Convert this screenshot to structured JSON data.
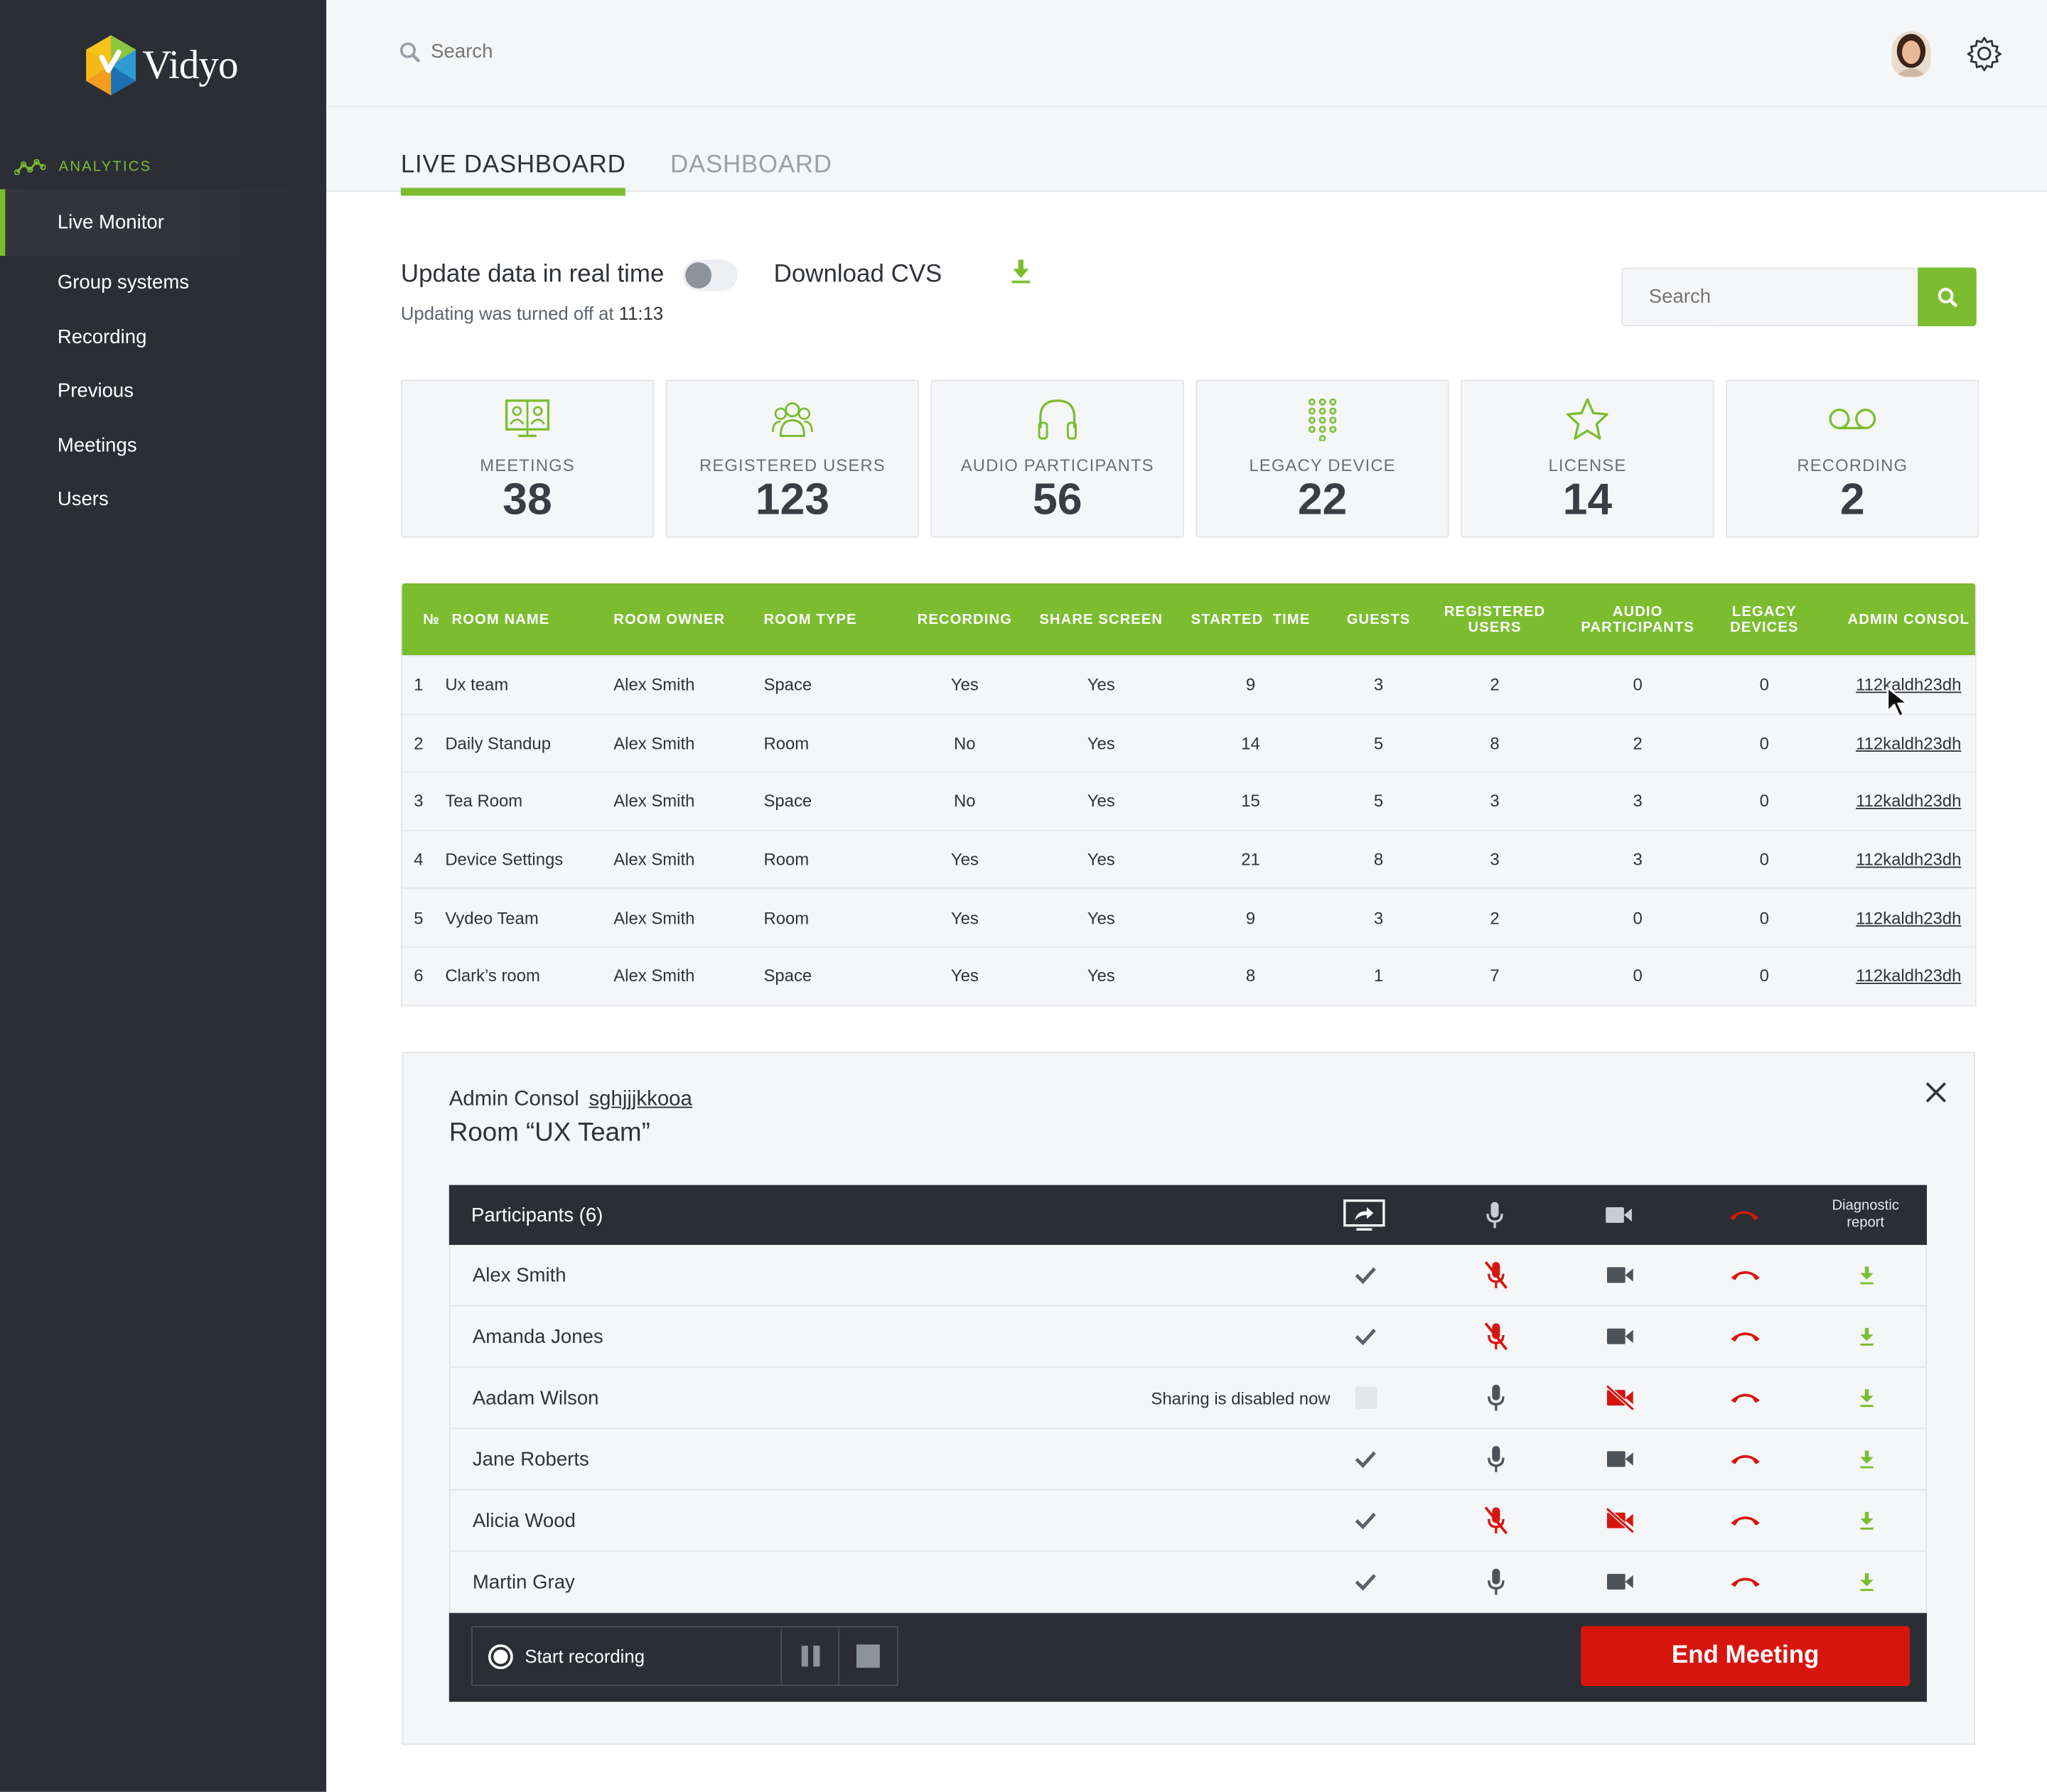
{
  "brand": {
    "name": "Vidyo"
  },
  "sidebar": {
    "section": "ANALYTICS",
    "items": [
      {
        "label": "Live Monitor",
        "active": true
      },
      {
        "label": "Group systems"
      },
      {
        "label": "Recording"
      },
      {
        "label": "Previous"
      },
      {
        "label": "Meetings"
      },
      {
        "label": "Users"
      }
    ]
  },
  "topbar": {
    "search_placeholder": "Search"
  },
  "tabs": [
    {
      "label": "LIVE DASHBOARD",
      "active": true
    },
    {
      "label": "DASHBOARD",
      "active": false
    }
  ],
  "controls": {
    "update_label": "Update data in real time",
    "update_on": false,
    "download_label": "Download CVS",
    "status_prefix": "Updating was turned off at",
    "status_time": "11:13",
    "search_placeholder": "Search"
  },
  "stats": [
    {
      "label": "MEETINGS",
      "value": "38",
      "icon": "meetings-icon"
    },
    {
      "label": "REGISTERED USERS",
      "value": "123",
      "icon": "users-group-icon"
    },
    {
      "label": "AUDIO PARTICIPANTS",
      "value": "56",
      "icon": "headphones-icon"
    },
    {
      "label": "LEGACY DEVICE",
      "value": "22",
      "icon": "keypad-icon"
    },
    {
      "label": "LICENSE",
      "value": "14",
      "icon": "star-icon"
    },
    {
      "label": "RECORDING",
      "value": "2",
      "icon": "voicemail-icon"
    }
  ],
  "rooms_table": {
    "headers": {
      "no": "№",
      "room": "ROOM NAME",
      "owner": "ROOM OWNER",
      "type": "ROOM TYPE",
      "rec": "RECORDING",
      "share": "SHARE SCREEN",
      "start": "STARTED  TIME",
      "guest": "GUESTS",
      "reg": "REGISTERED USERS",
      "aud": "AUDIO PARTICIPANTS",
      "leg": "LEGACY DEVICES",
      "adm": "ADMIN CONSOL"
    },
    "rows": [
      {
        "no": "1",
        "room": "Ux team",
        "owner": "Alex Smith",
        "type": "Space",
        "rec": "Yes",
        "share": "Yes",
        "start": "9",
        "guest": "3",
        "reg": "2",
        "aud": "0",
        "leg": "0",
        "adm": "112kaldh23dh"
      },
      {
        "no": "2",
        "room": "Daily Standup",
        "owner": "Alex Smith",
        "type": "Room",
        "rec": "No",
        "share": "Yes",
        "start": "14",
        "guest": "5",
        "reg": "8",
        "aud": "2",
        "leg": "0",
        "adm": "112kaldh23dh"
      },
      {
        "no": "3",
        "room": "Tea Room",
        "owner": "Alex Smith",
        "type": "Space",
        "rec": "No",
        "share": "Yes",
        "start": "15",
        "guest": "5",
        "reg": "3",
        "aud": "3",
        "leg": "0",
        "adm": "112kaldh23dh"
      },
      {
        "no": "4",
        "room": "Device Settings",
        "owner": "Alex Smith",
        "type": "Room",
        "rec": "Yes",
        "share": "Yes",
        "start": "21",
        "guest": "8",
        "reg": "3",
        "aud": "3",
        "leg": "0",
        "adm": "112kaldh23dh"
      },
      {
        "no": "5",
        "room": "Vydeo Team",
        "owner": "Alex Smith",
        "type": "Room",
        "rec": "Yes",
        "share": "Yes",
        "start": "9",
        "guest": "3",
        "reg": "2",
        "aud": "0",
        "leg": "0",
        "adm": "112kaldh23dh"
      },
      {
        "no": "6",
        "room": "Clark’s room",
        "owner": "Alex Smith",
        "type": "Space",
        "rec": "Yes",
        "share": "Yes",
        "start": "8",
        "guest": "1",
        "reg": "7",
        "aud": "0",
        "leg": "0",
        "adm": "112kaldh23dh"
      }
    ]
  },
  "admin": {
    "title": "Admin Consol",
    "code": "sghjjjkkooa",
    "room": "Room “UX Team”",
    "participants_header": "Participants (6)",
    "diag_header": "Diagnostic report",
    "sharing_disabled_text": "Sharing is disabled now",
    "participants": [
      {
        "name": "Alex Smith",
        "share": "checked",
        "mic": "muted",
        "cam": "on"
      },
      {
        "name": "Amanda Jones",
        "share": "checked",
        "mic": "muted",
        "cam": "on"
      },
      {
        "name": "Aadam Wilson",
        "share": "disabled",
        "mic": "on",
        "cam": "off"
      },
      {
        "name": "Jane Roberts",
        "share": "checked",
        "mic": "on",
        "cam": "on"
      },
      {
        "name": "Alicia Wood",
        "share": "checked",
        "mic": "muted",
        "cam": "off"
      },
      {
        "name": "Martin Gray",
        "share": "checked",
        "mic": "on",
        "cam": "on"
      }
    ],
    "start_recording": "Start recording",
    "end_meeting": "End Meeting"
  },
  "colors": {
    "accent": "#7bbd2f",
    "sidebar": "#2b2e35",
    "danger": "#d7150f"
  }
}
